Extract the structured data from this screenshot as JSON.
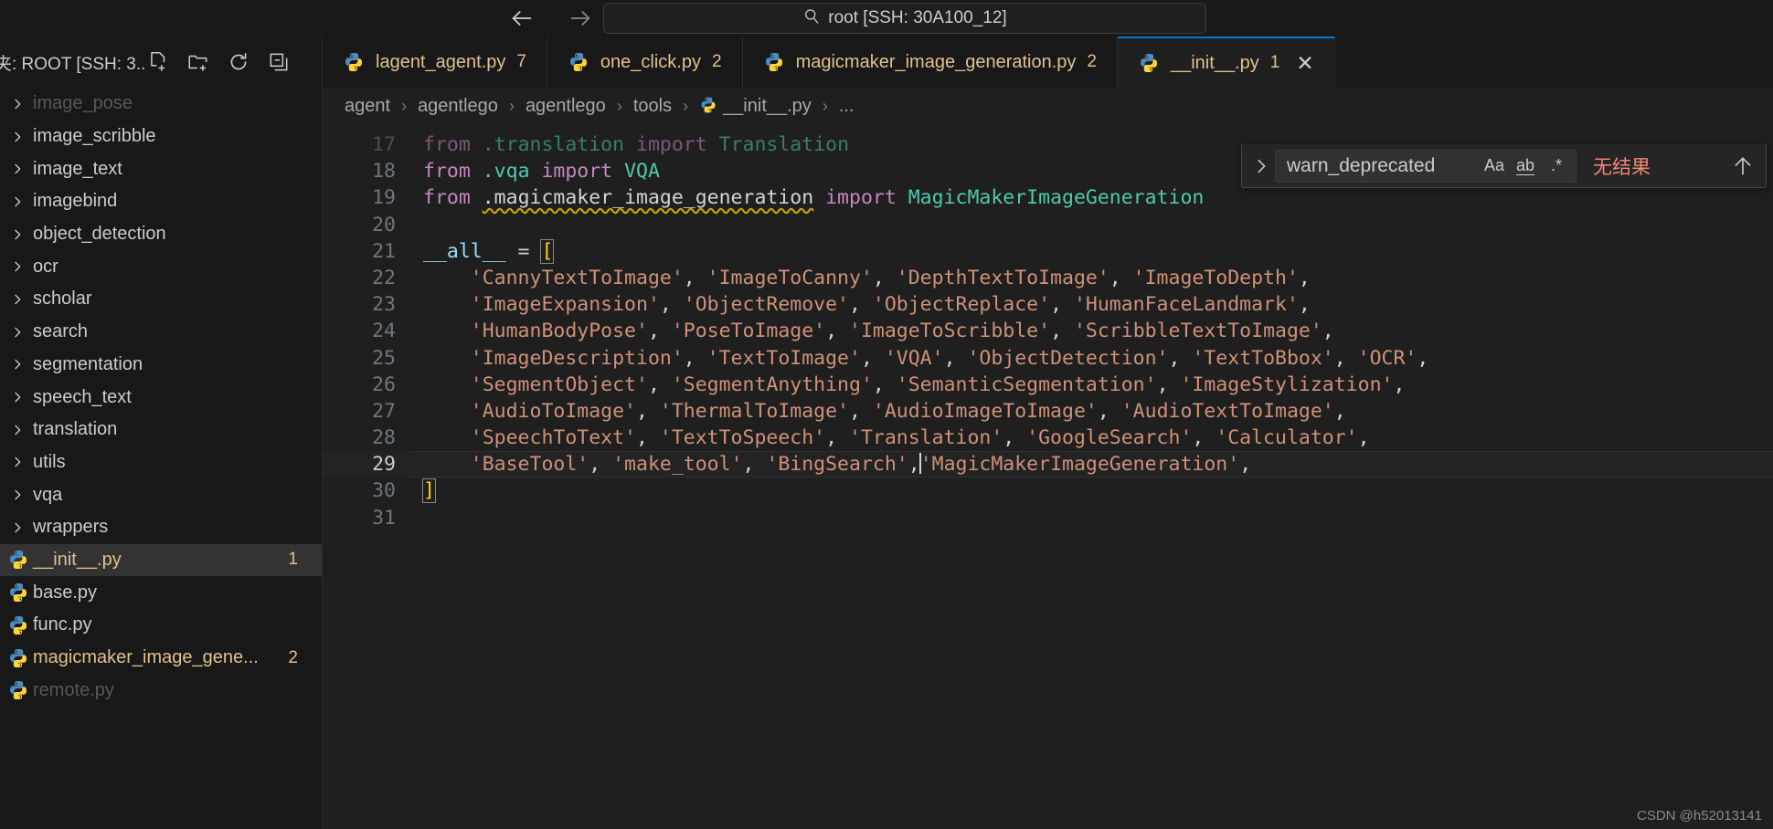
{
  "titlebar": {
    "back_icon": "arrow-left-icon",
    "forward_icon": "arrow-right-icon",
    "quick_input_icon": "search-icon",
    "quick_input_value": "root [SSH: 30A100_12]"
  },
  "sidebar": {
    "title": "夹: ROOT [SSH: 3...",
    "actions": [
      {
        "name": "new-file-icon",
        "tooltip": "New File"
      },
      {
        "name": "new-folder-icon",
        "tooltip": "New Folder"
      },
      {
        "name": "refresh-icon",
        "tooltip": "Refresh Explorer"
      },
      {
        "name": "collapse-all-icon",
        "tooltip": "Collapse Folders in Explorer"
      }
    ],
    "tree": [
      {
        "label": "image_pose",
        "type": "folder",
        "expanded": false,
        "partial": true,
        "badge": ""
      },
      {
        "label": "image_scribble",
        "type": "folder",
        "expanded": false,
        "badge": ""
      },
      {
        "label": "image_text",
        "type": "folder",
        "expanded": false,
        "badge": ""
      },
      {
        "label": "imagebind",
        "type": "folder",
        "expanded": false,
        "badge": ""
      },
      {
        "label": "object_detection",
        "type": "folder",
        "expanded": false,
        "badge": ""
      },
      {
        "label": "ocr",
        "type": "folder",
        "expanded": false,
        "badge": ""
      },
      {
        "label": "scholar",
        "type": "folder",
        "expanded": false,
        "badge": ""
      },
      {
        "label": "search",
        "type": "folder",
        "expanded": false,
        "badge": ""
      },
      {
        "label": "segmentation",
        "type": "folder",
        "expanded": false,
        "badge": ""
      },
      {
        "label": "speech_text",
        "type": "folder",
        "expanded": false,
        "badge": ""
      },
      {
        "label": "translation",
        "type": "folder",
        "expanded": false,
        "badge": ""
      },
      {
        "label": "utils",
        "type": "folder",
        "expanded": false,
        "badge": ""
      },
      {
        "label": "vqa",
        "type": "folder",
        "expanded": false,
        "badge": ""
      },
      {
        "label": "wrappers",
        "type": "folder",
        "expanded": false,
        "badge": ""
      },
      {
        "label": "__init__.py",
        "type": "file",
        "selected": true,
        "modified": true,
        "badge": "1"
      },
      {
        "label": "base.py",
        "type": "file",
        "badge": ""
      },
      {
        "label": "func.py",
        "type": "file",
        "badge": ""
      },
      {
        "label": "magicmaker_image_gene...",
        "type": "file",
        "modified": true,
        "badge": "2"
      },
      {
        "label": "remote.py",
        "type": "file",
        "partial": true,
        "badge": ""
      }
    ]
  },
  "tabs": [
    {
      "label": "lagent_agent.py",
      "count": "7",
      "active": false,
      "icon": "python-icon"
    },
    {
      "label": "one_click.py",
      "count": "2",
      "active": false,
      "icon": "python-icon"
    },
    {
      "label": "magicmaker_image_generation.py",
      "count": "2",
      "active": false,
      "icon": "python-icon"
    },
    {
      "label": "__init__.py",
      "count": "1",
      "active": true,
      "icon": "python-icon",
      "close_icon": "close-icon"
    }
  ],
  "breadcrumb": [
    {
      "label": "agent",
      "icon": ""
    },
    {
      "label": "agentlego",
      "icon": ""
    },
    {
      "label": "agentlego",
      "icon": ""
    },
    {
      "label": "tools",
      "icon": ""
    },
    {
      "label": "__init__.py",
      "icon": "python-icon"
    },
    {
      "label": "...",
      "icon": ""
    }
  ],
  "find_widget": {
    "expand_icon": "chevron-right-icon",
    "query": "warn_deprecated",
    "options": [
      {
        "name": "match-case-icon",
        "label": "Aa"
      },
      {
        "name": "whole-word-icon",
        "label": "ab"
      },
      {
        "name": "regex-icon",
        "label": ".*"
      }
    ],
    "result_text": "无结果",
    "prev_icon": "arrow-up-icon"
  },
  "editor": {
    "lines": [
      {
        "num": "17",
        "partial": true,
        "tokens": [
          {
            "t": "from ",
            "c": "k"
          },
          {
            "t": ".translation",
            "c": "mod"
          },
          {
            "t": " import ",
            "c": "k"
          },
          {
            "t": "Translation",
            "c": "cls"
          }
        ]
      },
      {
        "num": "18",
        "tokens": [
          {
            "t": "from ",
            "c": "k"
          },
          {
            "t": ".vqa",
            "c": "mod"
          },
          {
            "t": " import ",
            "c": "k"
          },
          {
            "t": "VQA",
            "c": "cls"
          }
        ]
      },
      {
        "num": "19",
        "dirty": "mod",
        "tokens": [
          {
            "t": "from ",
            "c": "k"
          },
          {
            "t": ".magicmaker_image_generation",
            "c": "p squiggle"
          },
          {
            "t": " import ",
            "c": "k"
          },
          {
            "t": "MagicMakerImageGeneration",
            "c": "cls"
          }
        ]
      },
      {
        "num": "20",
        "tokens": []
      },
      {
        "num": "21",
        "tokens": [
          {
            "t": "__all__",
            "c": "v"
          },
          {
            "t": " = ",
            "c": "p"
          },
          {
            "t": "[",
            "c": "br brbox"
          }
        ]
      },
      {
        "num": "22",
        "tokens": [
          {
            "t": "    'CannyTextToImage'",
            "c": "s"
          },
          {
            "t": ", ",
            "c": "p"
          },
          {
            "t": "'ImageToCanny'",
            "c": "s"
          },
          {
            "t": ", ",
            "c": "p"
          },
          {
            "t": "'DepthTextToImage'",
            "c": "s"
          },
          {
            "t": ", ",
            "c": "p"
          },
          {
            "t": "'ImageToDepth'",
            "c": "s"
          },
          {
            "t": ",",
            "c": "p"
          }
        ]
      },
      {
        "num": "23",
        "tokens": [
          {
            "t": "    'ImageExpansion'",
            "c": "s"
          },
          {
            "t": ", ",
            "c": "p"
          },
          {
            "t": "'ObjectRemove'",
            "c": "s"
          },
          {
            "t": ", ",
            "c": "p"
          },
          {
            "t": "'ObjectReplace'",
            "c": "s"
          },
          {
            "t": ", ",
            "c": "p"
          },
          {
            "t": "'HumanFaceLandmark'",
            "c": "s"
          },
          {
            "t": ",",
            "c": "p"
          }
        ]
      },
      {
        "num": "24",
        "tokens": [
          {
            "t": "    'HumanBodyPose'",
            "c": "s"
          },
          {
            "t": ", ",
            "c": "p"
          },
          {
            "t": "'PoseToImage'",
            "c": "s"
          },
          {
            "t": ", ",
            "c": "p"
          },
          {
            "t": "'ImageToScribble'",
            "c": "s"
          },
          {
            "t": ", ",
            "c": "p"
          },
          {
            "t": "'ScribbleTextToImage'",
            "c": "s"
          },
          {
            "t": ",",
            "c": "p"
          }
        ]
      },
      {
        "num": "25",
        "tokens": [
          {
            "t": "    'ImageDescription'",
            "c": "s"
          },
          {
            "t": ", ",
            "c": "p"
          },
          {
            "t": "'TextToImage'",
            "c": "s"
          },
          {
            "t": ", ",
            "c": "p"
          },
          {
            "t": "'VQA'",
            "c": "s"
          },
          {
            "t": ", ",
            "c": "p"
          },
          {
            "t": "'ObjectDetection'",
            "c": "s"
          },
          {
            "t": ", ",
            "c": "p"
          },
          {
            "t": "'TextToBbox'",
            "c": "s"
          },
          {
            "t": ", ",
            "c": "p"
          },
          {
            "t": "'OCR'",
            "c": "s"
          },
          {
            "t": ",",
            "c": "p"
          }
        ]
      },
      {
        "num": "26",
        "tokens": [
          {
            "t": "    'SegmentObject'",
            "c": "s"
          },
          {
            "t": ", ",
            "c": "p"
          },
          {
            "t": "'SegmentAnything'",
            "c": "s"
          },
          {
            "t": ", ",
            "c": "p"
          },
          {
            "t": "'SemanticSegmentation'",
            "c": "s"
          },
          {
            "t": ", ",
            "c": "p"
          },
          {
            "t": "'ImageStylization'",
            "c": "s"
          },
          {
            "t": ",",
            "c": "p"
          }
        ]
      },
      {
        "num": "27",
        "tokens": [
          {
            "t": "    'AudioToImage'",
            "c": "s"
          },
          {
            "t": ", ",
            "c": "p"
          },
          {
            "t": "'ThermalToImage'",
            "c": "s"
          },
          {
            "t": ", ",
            "c": "p"
          },
          {
            "t": "'AudioImageToImage'",
            "c": "s"
          },
          {
            "t": ", ",
            "c": "p"
          },
          {
            "t": "'AudioTextToImage'",
            "c": "s"
          },
          {
            "t": ",",
            "c": "p"
          }
        ]
      },
      {
        "num": "28",
        "tokens": [
          {
            "t": "    'SpeechToText'",
            "c": "s"
          },
          {
            "t": ", ",
            "c": "p"
          },
          {
            "t": "'TextToSpeech'",
            "c": "s"
          },
          {
            "t": ", ",
            "c": "p"
          },
          {
            "t": "'Translation'",
            "c": "s"
          },
          {
            "t": ", ",
            "c": "p"
          },
          {
            "t": "'GoogleSearch'",
            "c": "s"
          },
          {
            "t": ", ",
            "c": "p"
          },
          {
            "t": "'Calculator'",
            "c": "s"
          },
          {
            "t": ",",
            "c": "p"
          }
        ]
      },
      {
        "num": "29",
        "current": true,
        "dirty": "edit",
        "tokens": [
          {
            "t": "    'BaseTool'",
            "c": "s"
          },
          {
            "t": ", ",
            "c": "p"
          },
          {
            "t": "'make_tool'",
            "c": "s"
          },
          {
            "t": ", ",
            "c": "p"
          },
          {
            "t": "'BingSearch'",
            "c": "s"
          },
          {
            "t": ",",
            "c": "p"
          },
          {
            "t": "|CARET|",
            "c": "caret"
          },
          {
            "t": "'MagicMakerImageGeneration'",
            "c": "s"
          },
          {
            "t": ",",
            "c": "p"
          }
        ]
      },
      {
        "num": "30",
        "tokens": [
          {
            "t": "]",
            "c": "br brbox"
          }
        ]
      },
      {
        "num": "31",
        "tokens": []
      }
    ]
  },
  "watermark": "CSDN @h52013141"
}
